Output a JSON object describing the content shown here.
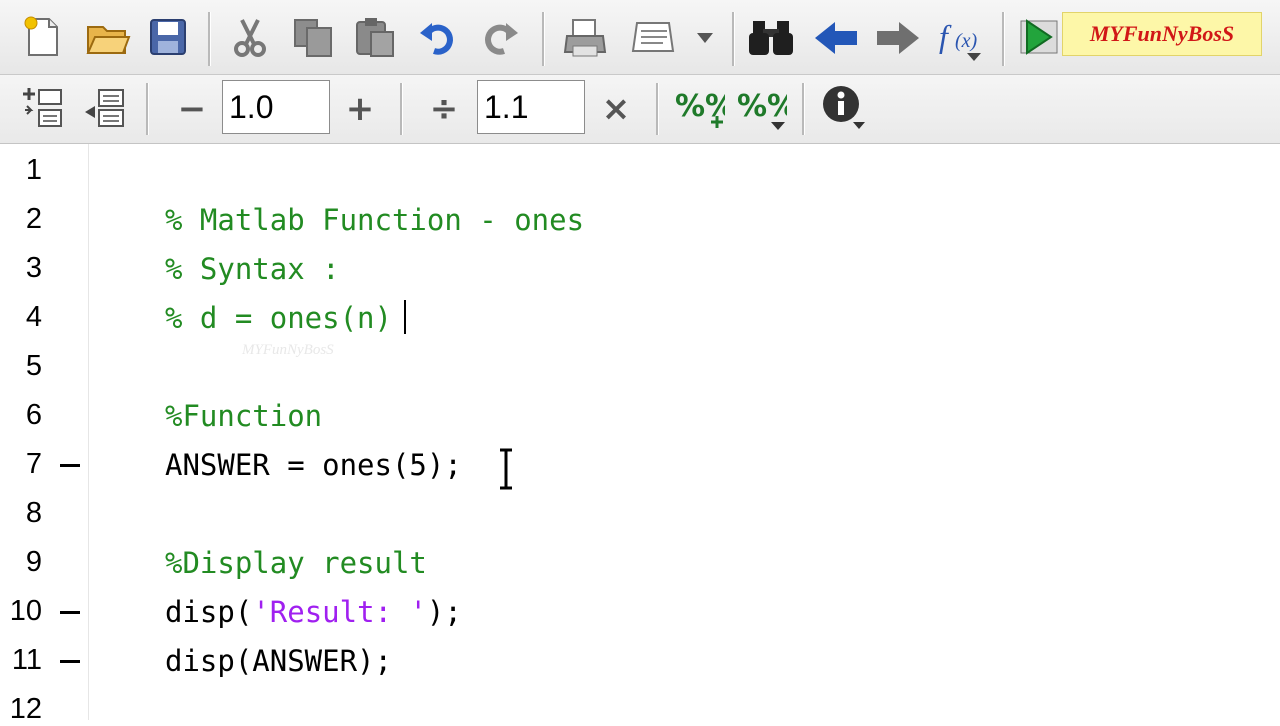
{
  "toolbar_top": {
    "buttons": [
      {
        "name": "new-file",
        "icon": "new-file-icon"
      },
      {
        "name": "open-file",
        "icon": "folder-open-icon"
      },
      {
        "name": "save",
        "icon": "save-icon"
      },
      {
        "name": "cut",
        "icon": "scissors-icon"
      },
      {
        "name": "copy",
        "icon": "copy-icon"
      },
      {
        "name": "paste",
        "icon": "paste-icon"
      },
      {
        "name": "undo",
        "icon": "undo-icon"
      },
      {
        "name": "redo",
        "icon": "redo-icon"
      },
      {
        "name": "print",
        "icon": "print-icon"
      },
      {
        "name": "page-setup",
        "icon": "page-setup-icon"
      },
      {
        "name": "find",
        "icon": "binoculars-icon"
      },
      {
        "name": "back",
        "icon": "arrow-left-icon"
      },
      {
        "name": "forward",
        "icon": "arrow-right-icon"
      },
      {
        "name": "function",
        "icon": "function-icon"
      },
      {
        "name": "run",
        "icon": "run-icon"
      }
    ],
    "brand_text": "MYFunNyBosS"
  },
  "toolbar_cell": {
    "decrement_value": "1.0",
    "divide_value": "1.1",
    "buttons": [
      {
        "name": "insert-cell-break",
        "icon": "insert-cell-icon"
      },
      {
        "name": "evaluate-cell",
        "icon": "evaluate-cell-icon"
      },
      {
        "name": "decrement",
        "icon": "minus-icon"
      },
      {
        "name": "increment",
        "icon": "plus-icon"
      },
      {
        "name": "divide",
        "icon": "divide-icon"
      },
      {
        "name": "multiply",
        "icon": "multiply-icon"
      },
      {
        "name": "comment",
        "icon": "comment-percent-icon"
      },
      {
        "name": "uncomment",
        "icon": "uncomment-percent-icon"
      },
      {
        "name": "info",
        "icon": "info-icon"
      }
    ]
  },
  "editor": {
    "lines": [
      {
        "num": "1",
        "text": "",
        "type": "blank",
        "executable": false
      },
      {
        "num": "2",
        "text": "% Matlab Function - ones",
        "type": "comment",
        "executable": false
      },
      {
        "num": "3",
        "text": "% Syntax :",
        "type": "comment",
        "executable": false
      },
      {
        "num": "4",
        "text": "% d = ones(n)",
        "type": "comment",
        "executable": false
      },
      {
        "num": "5",
        "text": "",
        "type": "blank",
        "executable": false
      },
      {
        "num": "6",
        "text": "%Function",
        "type": "comment",
        "executable": false
      },
      {
        "num": "7",
        "text": "ANSWER = ones(5);",
        "type": "code",
        "executable": true
      },
      {
        "num": "8",
        "text": "",
        "type": "blank",
        "executable": false
      },
      {
        "num": "9",
        "text": "%Display result",
        "type": "comment",
        "executable": false
      },
      {
        "num": "10",
        "code_before": "disp(",
        "string": "'Result: '",
        "code_after": ");",
        "type": "mixed",
        "executable": true
      },
      {
        "num": "11",
        "text": "disp(ANSWER);",
        "type": "code",
        "executable": true
      },
      {
        "num": "12",
        "text": "",
        "type": "blank",
        "executable": false
      }
    ],
    "watermark": "MYFunNyBosS",
    "colors": {
      "comment": "#228b22",
      "string": "#a020f0",
      "code": "#000000"
    }
  }
}
